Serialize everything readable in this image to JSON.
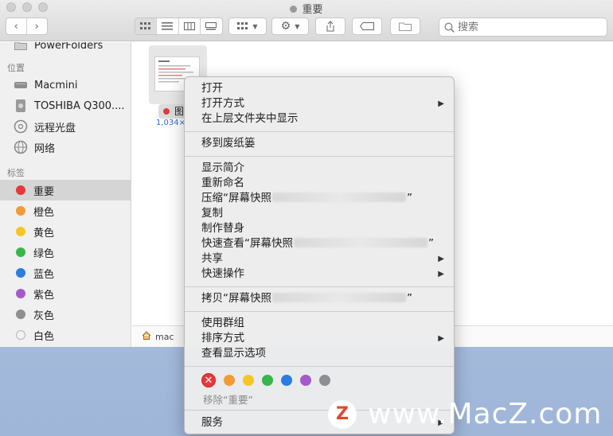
{
  "window": {
    "title": "重要",
    "search_placeholder": "搜索",
    "path_label": "mac"
  },
  "sidebar": {
    "clipped_item": "PowerFolders",
    "locations_header": "位置",
    "locations": [
      {
        "label": "Macmini",
        "icon": "computer-icon"
      },
      {
        "label": "TOSHIBA Q300....",
        "icon": "disk-icon"
      },
      {
        "label": "远程光盘",
        "icon": "optical-disc-icon"
      },
      {
        "label": "网络",
        "icon": "globe-icon"
      }
    ],
    "tags_header": "标签",
    "tags": [
      {
        "label": "重要",
        "color": "#e5393b"
      },
      {
        "label": "橙色",
        "color": "#f29a38"
      },
      {
        "label": "黄色",
        "color": "#f5c623"
      },
      {
        "label": "绿色",
        "color": "#39b54a"
      },
      {
        "label": "蓝色",
        "color": "#2b7de0"
      },
      {
        "label": "紫色",
        "color": "#a45bc9"
      },
      {
        "label": "灰色",
        "color": "#8e8e93"
      },
      {
        "label": "白色",
        "color": "#f2f2f2"
      }
    ],
    "selected_tag": "重要"
  },
  "file": {
    "name_prefix": "图",
    "size_text": "1,034×"
  },
  "context_menu": {
    "open": "打开",
    "open_with": "打开方式",
    "show_in_enclosing": "在上层文件夹中显示",
    "move_to_trash": "移到废纸篓",
    "get_info": "显示简介",
    "rename": "重新命名",
    "compress_prefix": "压缩“屏幕快照",
    "compress_suffix": "”",
    "duplicate": "复制",
    "make_alias": "制作替身",
    "quick_look_prefix": "快速查看“屏幕快照",
    "quick_look_suffix": "”",
    "share": "共享",
    "quick_actions": "快速操作",
    "copy_prefix": "拷贝“屏幕快照",
    "copy_suffix": "”",
    "use_groups": "使用群组",
    "sort_by": "排序方式",
    "show_view_options": "查看显示选项",
    "tag_colors": [
      "#f29a38",
      "#f5c623",
      "#39b54a",
      "#2b7de0",
      "#a45bc9",
      "#8e8e93"
    ],
    "remove_tag": "移除“重要”",
    "services": "服务"
  },
  "watermark": {
    "logo_letter": "Z",
    "text": "www.MacZ.com"
  }
}
